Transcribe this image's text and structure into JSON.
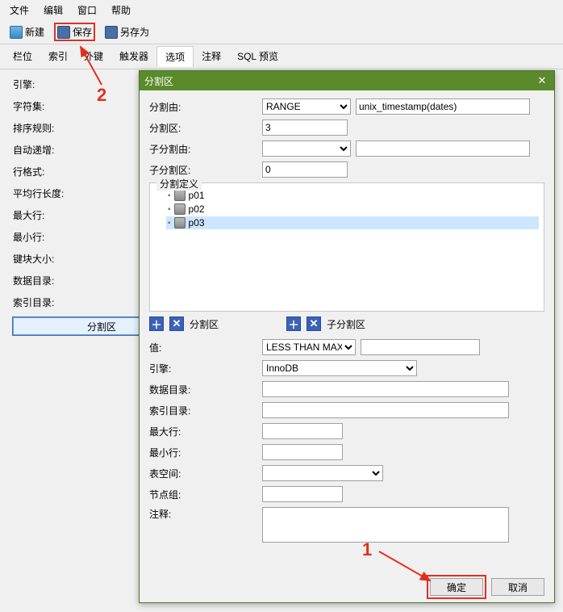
{
  "menu": {
    "file": "文件",
    "edit": "编辑",
    "window": "窗口",
    "help": "帮助"
  },
  "toolbar": {
    "new": "新建",
    "save": "保存",
    "saveas": "另存为"
  },
  "tabs": {
    "fields": "栏位",
    "indexes": "索引",
    "fk": "外键",
    "triggers": "触发器",
    "options": "选项",
    "comment": "注释",
    "sqlpreview": "SQL 预览"
  },
  "options": {
    "engine": "引擎:",
    "charset": "字符集:",
    "collation": "排序规则:",
    "autoinc": "自动递增:",
    "rowfmt": "行格式:",
    "avgrow": "平均行长度:",
    "maxrows": "最大行:",
    "minrows": "最小行:",
    "blocksize": "键块大小:",
    "datadir": "数据目录:",
    "indexdir": "索引目录:",
    "partition_btn": "分割区"
  },
  "dialog": {
    "title": "分割区",
    "partby": "分割由:",
    "partcount": "分割区:",
    "subpartby": "子分割由:",
    "subpartcount": "子分割区:",
    "partby_val": "RANGE",
    "partby_expr": "unix_timestamp(dates)",
    "partcount_val": "3",
    "subpartcount_val": "0",
    "def_legend": "分割定义",
    "tree": [
      "p01",
      "p02",
      "p03"
    ],
    "btn_part": "分割区",
    "btn_subpart": "子分割区",
    "value_lbl": "值:",
    "value_val": "LESS THAN MAX",
    "engine_lbl": "引擎:",
    "engine_val": "InnoDB",
    "datadir_lbl": "数据目录:",
    "indexdir_lbl": "索引目录:",
    "maxrows_lbl": "最大行:",
    "minrows_lbl": "最小行:",
    "tablespace_lbl": "表空间:",
    "nodegroup_lbl": "节点组:",
    "comment_lbl": "注释:",
    "ok": "确定",
    "cancel": "取消"
  },
  "annot": {
    "one": "1",
    "two": "2"
  }
}
